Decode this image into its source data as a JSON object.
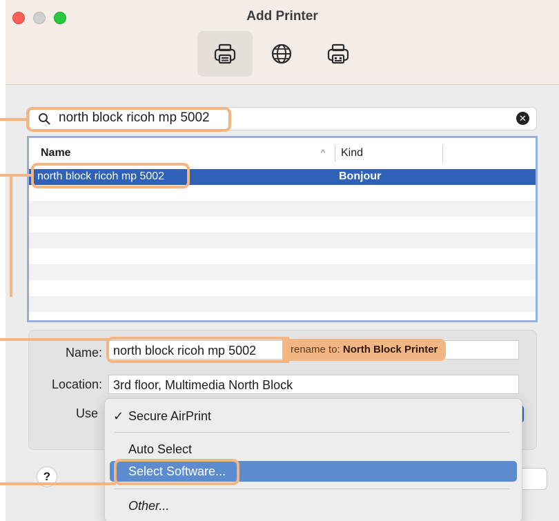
{
  "window": {
    "title": "Add Printer"
  },
  "toolbar": {
    "items": [
      "default-printers",
      "ip-printer",
      "windows-printer"
    ],
    "active": "default-printers"
  },
  "search": {
    "value": "north block ricoh mp 5002"
  },
  "table": {
    "columns": {
      "name": "Name",
      "kind": "Kind"
    },
    "rows": [
      {
        "name": "north block ricoh mp 5002",
        "kind": "Bonjour",
        "selected": true
      }
    ]
  },
  "details": {
    "name_label": "Name:",
    "name_value": "north block ricoh mp 5002",
    "location_label": "Location:",
    "location_value": "3rd floor, Multimedia North Block",
    "use_label": "Use"
  },
  "annotation": {
    "prefix": "rename to: ",
    "target": "North Block Printer"
  },
  "menu": {
    "check_mark": "✓",
    "items": [
      "Secure AirPrint",
      "Auto Select",
      "Select Software...",
      "Other..."
    ],
    "checked": "Secure AirPrint",
    "highlighted": "Select Software..."
  },
  "help": {
    "label": "?"
  },
  "colors": {
    "accent": "#2f62b6",
    "menu_highlight": "#5d8bd0",
    "annotation": "#f3b582",
    "table_border": "#93aedb"
  }
}
